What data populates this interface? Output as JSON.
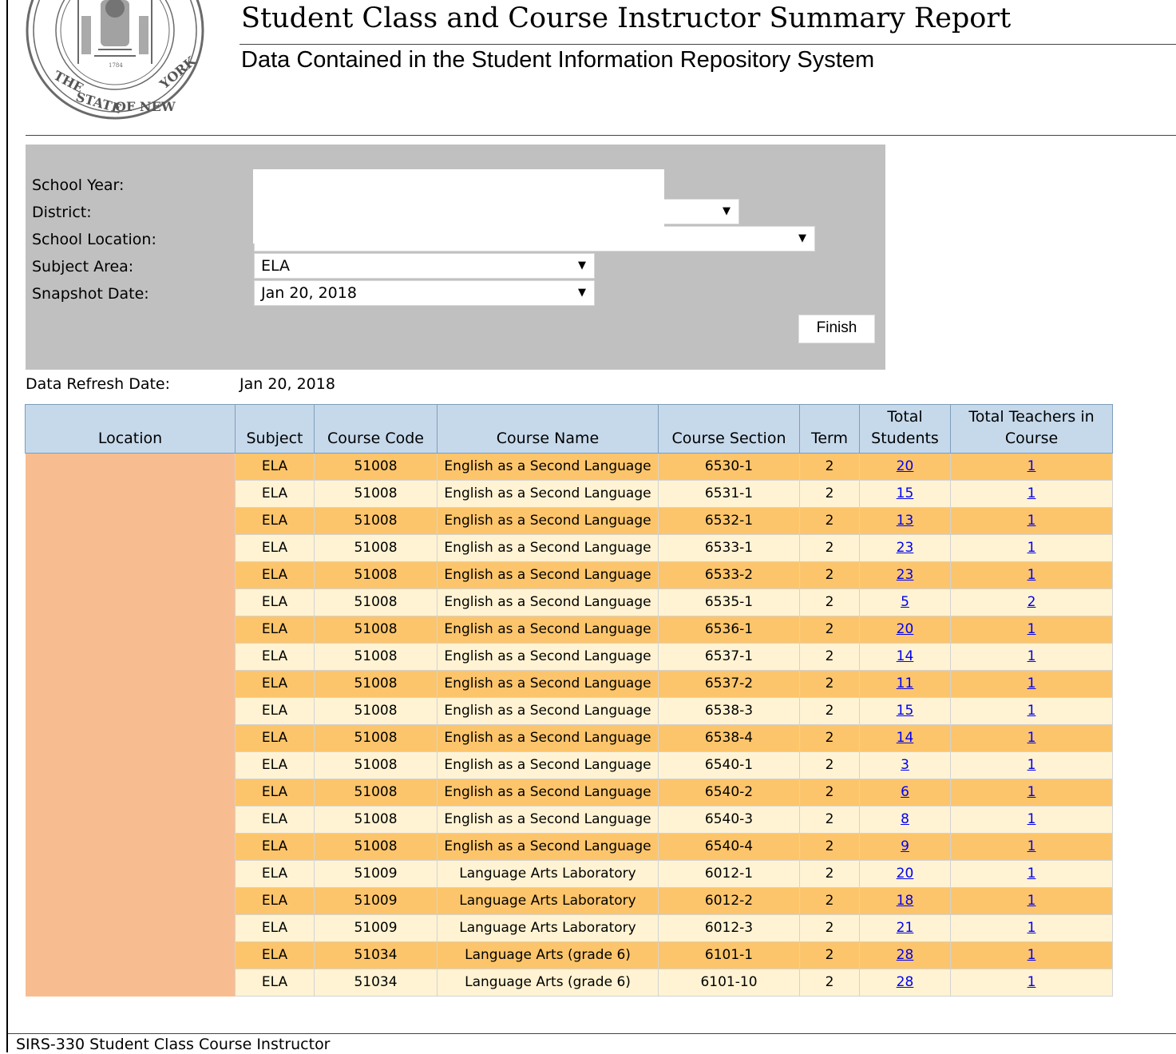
{
  "header": {
    "title": "Student Class and Course Instructor Summary Report",
    "subtitle": "Data Contained in the Student Information Repository System"
  },
  "filters": {
    "school_year_label": "School Year:",
    "district_label": "District:",
    "school_location_label": "School Location:",
    "subject_area_label": "Subject Area:",
    "snapshot_date_label": "Snapshot Date:",
    "subject_area_value": "ELA",
    "snapshot_date_value": "Jan 20, 2018",
    "finish_label": "Finish"
  },
  "refresh": {
    "label": "Data Refresh Date:",
    "value": "Jan 20, 2018"
  },
  "table": {
    "headers": {
      "location": "Location",
      "subject": "Subject",
      "course_code": "Course Code",
      "course_name": "Course Name",
      "course_section": "Course Section",
      "term": "Term",
      "total_students": "Total Students",
      "total_teachers": "Total Teachers in Course"
    },
    "rows": [
      {
        "subject": "ELA",
        "code": "51008",
        "name": "English as a Second Language",
        "section": "6530-1",
        "term": "2",
        "students": "20",
        "teachers": "1"
      },
      {
        "subject": "ELA",
        "code": "51008",
        "name": "English as a Second Language",
        "section": "6531-1",
        "term": "2",
        "students": "15",
        "teachers": "1"
      },
      {
        "subject": "ELA",
        "code": "51008",
        "name": "English as a Second Language",
        "section": "6532-1",
        "term": "2",
        "students": "13",
        "teachers": "1"
      },
      {
        "subject": "ELA",
        "code": "51008",
        "name": "English as a Second Language",
        "section": "6533-1",
        "term": "2",
        "students": "23",
        "teachers": "1"
      },
      {
        "subject": "ELA",
        "code": "51008",
        "name": "English as a Second Language",
        "section": "6533-2",
        "term": "2",
        "students": "23",
        "teachers": "1"
      },
      {
        "subject": "ELA",
        "code": "51008",
        "name": "English as a Second Language",
        "section": "6535-1",
        "term": "2",
        "students": "5",
        "teachers": "2"
      },
      {
        "subject": "ELA",
        "code": "51008",
        "name": "English as a Second Language",
        "section": "6536-1",
        "term": "2",
        "students": "20",
        "teachers": "1"
      },
      {
        "subject": "ELA",
        "code": "51008",
        "name": "English as a Second Language",
        "section": "6537-1",
        "term": "2",
        "students": "14",
        "teachers": "1"
      },
      {
        "subject": "ELA",
        "code": "51008",
        "name": "English as a Second Language",
        "section": "6537-2",
        "term": "2",
        "students": "11",
        "teachers": "1"
      },
      {
        "subject": "ELA",
        "code": "51008",
        "name": "English as a Second Language",
        "section": "6538-3",
        "term": "2",
        "students": "15",
        "teachers": "1"
      },
      {
        "subject": "ELA",
        "code": "51008",
        "name": "English as a Second Language",
        "section": "6538-4",
        "term": "2",
        "students": "14",
        "teachers": "1"
      },
      {
        "subject": "ELA",
        "code": "51008",
        "name": "English as a Second Language",
        "section": "6540-1",
        "term": "2",
        "students": "3",
        "teachers": "1"
      },
      {
        "subject": "ELA",
        "code": "51008",
        "name": "English as a Second Language",
        "section": "6540-2",
        "term": "2",
        "students": "6",
        "teachers": "1"
      },
      {
        "subject": "ELA",
        "code": "51008",
        "name": "English as a Second Language",
        "section": "6540-3",
        "term": "2",
        "students": "8",
        "teachers": "1"
      },
      {
        "subject": "ELA",
        "code": "51008",
        "name": "English as a Second Language",
        "section": "6540-4",
        "term": "2",
        "students": "9",
        "teachers": "1"
      },
      {
        "subject": "ELA",
        "code": "51009",
        "name": "Language Arts Laboratory",
        "section": "6012-1",
        "term": "2",
        "students": "20",
        "teachers": "1"
      },
      {
        "subject": "ELA",
        "code": "51009",
        "name": "Language Arts Laboratory",
        "section": "6012-2",
        "term": "2",
        "students": "18",
        "teachers": "1"
      },
      {
        "subject": "ELA",
        "code": "51009",
        "name": "Language Arts Laboratory",
        "section": "6012-3",
        "term": "2",
        "students": "21",
        "teachers": "1"
      },
      {
        "subject": "ELA",
        "code": "51034",
        "name": "Language Arts (grade 6)",
        "section": "6101-1",
        "term": "2",
        "students": "28",
        "teachers": "1"
      },
      {
        "subject": "ELA",
        "code": "51034",
        "name": "Language Arts (grade 6)",
        "section": "6101-10",
        "term": "2",
        "students": "28",
        "teachers": "1"
      }
    ]
  },
  "footer": {
    "text": "SIRS-330 Student Class Course Instructor"
  },
  "colors": {
    "header_bg": "#c6d9eb",
    "row_odd": "#fdc56b",
    "row_even": "#fff3d3",
    "location_cell": "#f7bd90",
    "filter_panel": "#c0c0c0",
    "link": "#0000ee"
  },
  "icons": {
    "seal": "state-seal-icon",
    "dropdown": "dropdown-arrow-icon"
  }
}
